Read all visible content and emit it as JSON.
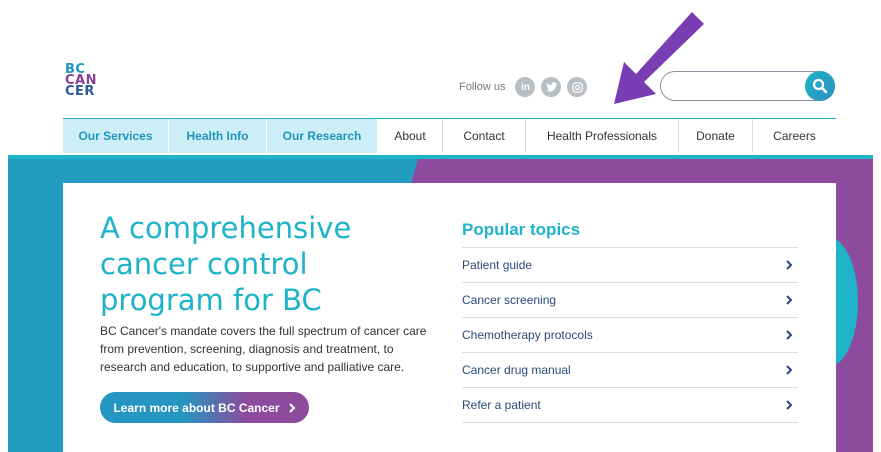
{
  "logo": {
    "line1": "BC",
    "line2": "CAN",
    "line3": "CER"
  },
  "header": {
    "follow_label": "Follow us",
    "social": [
      {
        "name": "linkedin-icon",
        "glyph": "in"
      },
      {
        "name": "twitter-icon",
        "glyph": "t"
      },
      {
        "name": "instagram-icon",
        "glyph": "◎"
      }
    ],
    "search": {
      "placeholder": "",
      "value": ""
    }
  },
  "nav": {
    "items": [
      {
        "label": "Our Services",
        "highlighted": true
      },
      {
        "label": "Health Info",
        "highlighted": true
      },
      {
        "label": "Our Research",
        "highlighted": true
      },
      {
        "label": "About",
        "highlighted": false
      },
      {
        "label": "Contact",
        "highlighted": false
      },
      {
        "label": "Health Professionals",
        "highlighted": false
      },
      {
        "label": "Donate",
        "highlighted": false
      },
      {
        "label": "Careers",
        "highlighted": false
      }
    ]
  },
  "hero": {
    "headline": "A comprehensive cancer control program for BC",
    "description": "BC Cancer's mandate covers the full spectrum of cancer care from prevention, screening, diagnosis and treatment, to research and education, to supportive and palliative care.",
    "cta_label": "Learn more about BC Cancer"
  },
  "topics": {
    "title": "Popular topics",
    "items": [
      {
        "label": "Patient guide"
      },
      {
        "label": "Cancer screening"
      },
      {
        "label": "Chemotherapy protocols"
      },
      {
        "label": "Cancer drug manual"
      },
      {
        "label": "Refer a patient"
      }
    ]
  },
  "colors": {
    "teal": "#1eb3c9",
    "blue": "#229dbf",
    "purple": "#8d4b9d",
    "arrow": "#7a3eb4",
    "nav_highlight": "#cdeef6"
  }
}
